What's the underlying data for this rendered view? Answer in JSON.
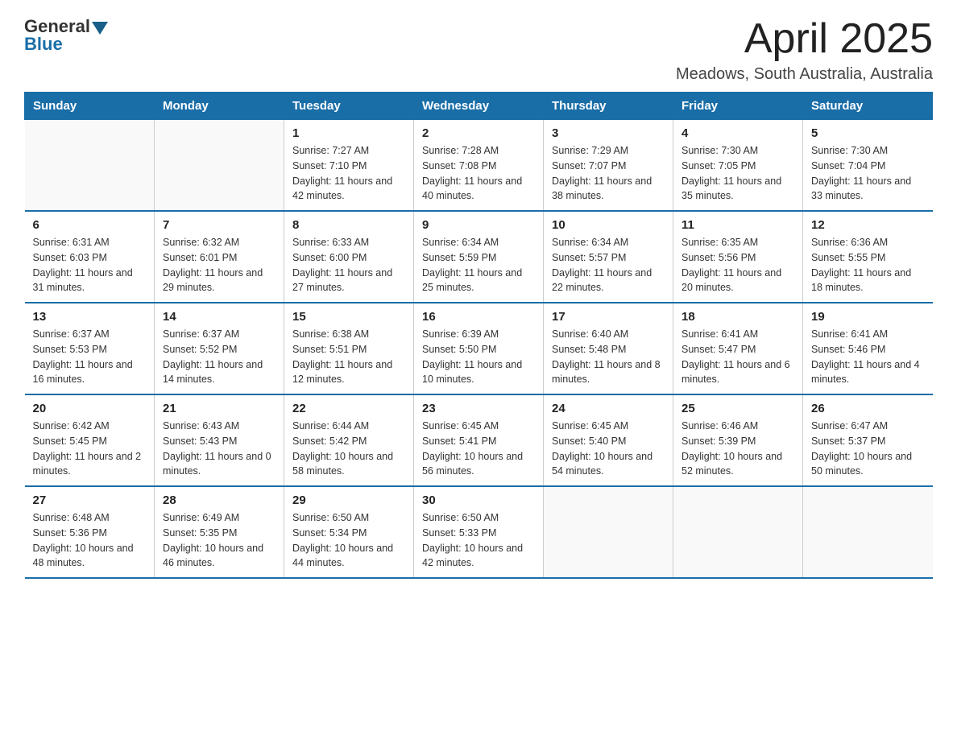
{
  "header": {
    "logo_general": "General",
    "logo_blue": "Blue",
    "title": "April 2025",
    "subtitle": "Meadows, South Australia, Australia"
  },
  "weekdays": [
    "Sunday",
    "Monday",
    "Tuesday",
    "Wednesday",
    "Thursday",
    "Friday",
    "Saturday"
  ],
  "weeks": [
    [
      {
        "day": "",
        "sunrise": "",
        "sunset": "",
        "daylight": ""
      },
      {
        "day": "",
        "sunrise": "",
        "sunset": "",
        "daylight": ""
      },
      {
        "day": "1",
        "sunrise": "Sunrise: 7:27 AM",
        "sunset": "Sunset: 7:10 PM",
        "daylight": "Daylight: 11 hours and 42 minutes."
      },
      {
        "day": "2",
        "sunrise": "Sunrise: 7:28 AM",
        "sunset": "Sunset: 7:08 PM",
        "daylight": "Daylight: 11 hours and 40 minutes."
      },
      {
        "day": "3",
        "sunrise": "Sunrise: 7:29 AM",
        "sunset": "Sunset: 7:07 PM",
        "daylight": "Daylight: 11 hours and 38 minutes."
      },
      {
        "day": "4",
        "sunrise": "Sunrise: 7:30 AM",
        "sunset": "Sunset: 7:05 PM",
        "daylight": "Daylight: 11 hours and 35 minutes."
      },
      {
        "day": "5",
        "sunrise": "Sunrise: 7:30 AM",
        "sunset": "Sunset: 7:04 PM",
        "daylight": "Daylight: 11 hours and 33 minutes."
      }
    ],
    [
      {
        "day": "6",
        "sunrise": "Sunrise: 6:31 AM",
        "sunset": "Sunset: 6:03 PM",
        "daylight": "Daylight: 11 hours and 31 minutes."
      },
      {
        "day": "7",
        "sunrise": "Sunrise: 6:32 AM",
        "sunset": "Sunset: 6:01 PM",
        "daylight": "Daylight: 11 hours and 29 minutes."
      },
      {
        "day": "8",
        "sunrise": "Sunrise: 6:33 AM",
        "sunset": "Sunset: 6:00 PM",
        "daylight": "Daylight: 11 hours and 27 minutes."
      },
      {
        "day": "9",
        "sunrise": "Sunrise: 6:34 AM",
        "sunset": "Sunset: 5:59 PM",
        "daylight": "Daylight: 11 hours and 25 minutes."
      },
      {
        "day": "10",
        "sunrise": "Sunrise: 6:34 AM",
        "sunset": "Sunset: 5:57 PM",
        "daylight": "Daylight: 11 hours and 22 minutes."
      },
      {
        "day": "11",
        "sunrise": "Sunrise: 6:35 AM",
        "sunset": "Sunset: 5:56 PM",
        "daylight": "Daylight: 11 hours and 20 minutes."
      },
      {
        "day": "12",
        "sunrise": "Sunrise: 6:36 AM",
        "sunset": "Sunset: 5:55 PM",
        "daylight": "Daylight: 11 hours and 18 minutes."
      }
    ],
    [
      {
        "day": "13",
        "sunrise": "Sunrise: 6:37 AM",
        "sunset": "Sunset: 5:53 PM",
        "daylight": "Daylight: 11 hours and 16 minutes."
      },
      {
        "day": "14",
        "sunrise": "Sunrise: 6:37 AM",
        "sunset": "Sunset: 5:52 PM",
        "daylight": "Daylight: 11 hours and 14 minutes."
      },
      {
        "day": "15",
        "sunrise": "Sunrise: 6:38 AM",
        "sunset": "Sunset: 5:51 PM",
        "daylight": "Daylight: 11 hours and 12 minutes."
      },
      {
        "day": "16",
        "sunrise": "Sunrise: 6:39 AM",
        "sunset": "Sunset: 5:50 PM",
        "daylight": "Daylight: 11 hours and 10 minutes."
      },
      {
        "day": "17",
        "sunrise": "Sunrise: 6:40 AM",
        "sunset": "Sunset: 5:48 PM",
        "daylight": "Daylight: 11 hours and 8 minutes."
      },
      {
        "day": "18",
        "sunrise": "Sunrise: 6:41 AM",
        "sunset": "Sunset: 5:47 PM",
        "daylight": "Daylight: 11 hours and 6 minutes."
      },
      {
        "day": "19",
        "sunrise": "Sunrise: 6:41 AM",
        "sunset": "Sunset: 5:46 PM",
        "daylight": "Daylight: 11 hours and 4 minutes."
      }
    ],
    [
      {
        "day": "20",
        "sunrise": "Sunrise: 6:42 AM",
        "sunset": "Sunset: 5:45 PM",
        "daylight": "Daylight: 11 hours and 2 minutes."
      },
      {
        "day": "21",
        "sunrise": "Sunrise: 6:43 AM",
        "sunset": "Sunset: 5:43 PM",
        "daylight": "Daylight: 11 hours and 0 minutes."
      },
      {
        "day": "22",
        "sunrise": "Sunrise: 6:44 AM",
        "sunset": "Sunset: 5:42 PM",
        "daylight": "Daylight: 10 hours and 58 minutes."
      },
      {
        "day": "23",
        "sunrise": "Sunrise: 6:45 AM",
        "sunset": "Sunset: 5:41 PM",
        "daylight": "Daylight: 10 hours and 56 minutes."
      },
      {
        "day": "24",
        "sunrise": "Sunrise: 6:45 AM",
        "sunset": "Sunset: 5:40 PM",
        "daylight": "Daylight: 10 hours and 54 minutes."
      },
      {
        "day": "25",
        "sunrise": "Sunrise: 6:46 AM",
        "sunset": "Sunset: 5:39 PM",
        "daylight": "Daylight: 10 hours and 52 minutes."
      },
      {
        "day": "26",
        "sunrise": "Sunrise: 6:47 AM",
        "sunset": "Sunset: 5:37 PM",
        "daylight": "Daylight: 10 hours and 50 minutes."
      }
    ],
    [
      {
        "day": "27",
        "sunrise": "Sunrise: 6:48 AM",
        "sunset": "Sunset: 5:36 PM",
        "daylight": "Daylight: 10 hours and 48 minutes."
      },
      {
        "day": "28",
        "sunrise": "Sunrise: 6:49 AM",
        "sunset": "Sunset: 5:35 PM",
        "daylight": "Daylight: 10 hours and 46 minutes."
      },
      {
        "day": "29",
        "sunrise": "Sunrise: 6:50 AM",
        "sunset": "Sunset: 5:34 PM",
        "daylight": "Daylight: 10 hours and 44 minutes."
      },
      {
        "day": "30",
        "sunrise": "Sunrise: 6:50 AM",
        "sunset": "Sunset: 5:33 PM",
        "daylight": "Daylight: 10 hours and 42 minutes."
      },
      {
        "day": "",
        "sunrise": "",
        "sunset": "",
        "daylight": ""
      },
      {
        "day": "",
        "sunrise": "",
        "sunset": "",
        "daylight": ""
      },
      {
        "day": "",
        "sunrise": "",
        "sunset": "",
        "daylight": ""
      }
    ]
  ]
}
